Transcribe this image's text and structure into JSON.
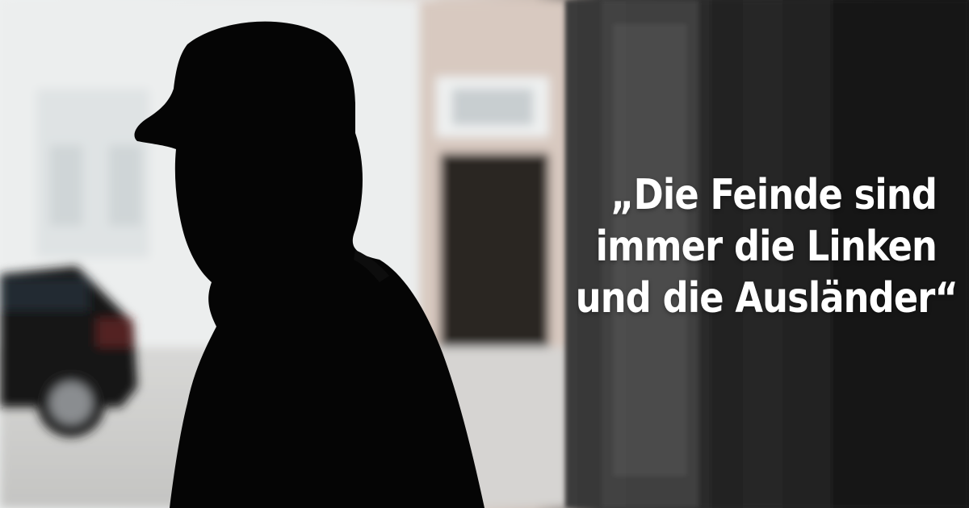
{
  "quote": {
    "lines": [
      "„Die Feinde sind",
      "immer die Linken",
      "und die Ausländer“"
    ]
  },
  "colors": {
    "text": "#ffffff",
    "silhouette": "#050505",
    "wall_light": "#eef0f0",
    "door_dark": "#1d1d1d"
  }
}
